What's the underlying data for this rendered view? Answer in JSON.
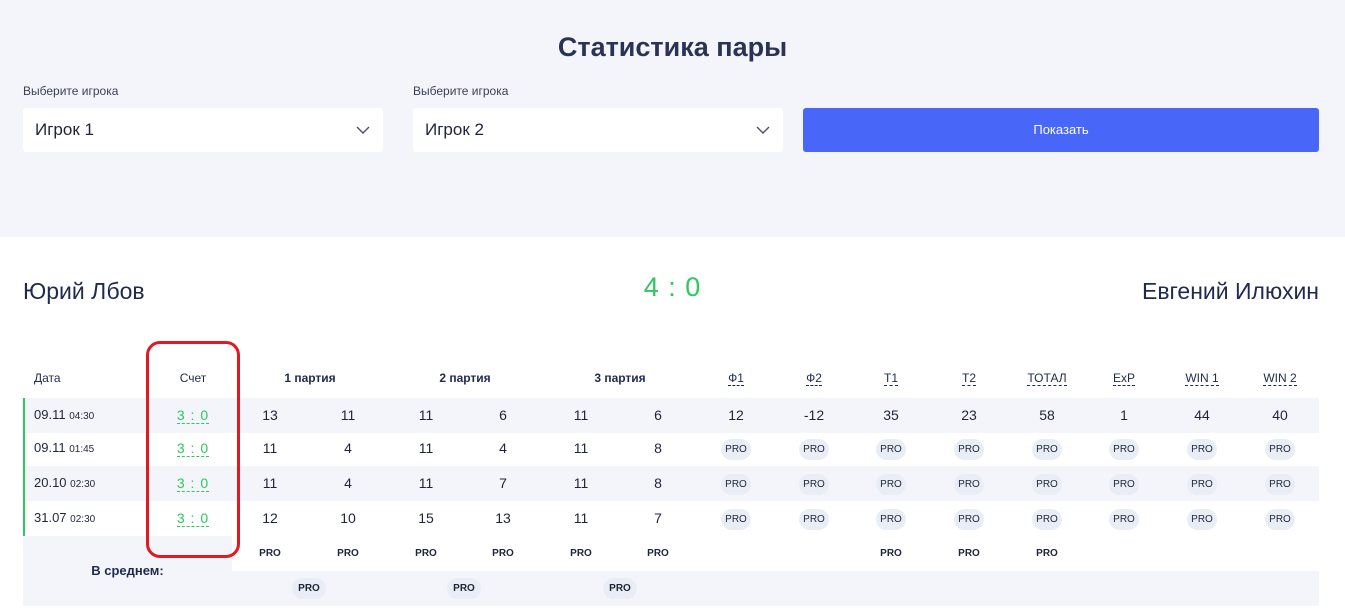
{
  "page": {
    "title": "Статистика пары"
  },
  "filters": {
    "player1_label": "Выберите игрока",
    "player1_value": "Игрок 1",
    "player2_label": "Выберите игрока",
    "player2_value": "Игрок 2",
    "show_button": "Показать"
  },
  "match": {
    "player1": "Юрий Лбов",
    "player2": "Евгений Илюхин",
    "total_score": "4 : 0"
  },
  "table": {
    "headers": {
      "date": "Дата",
      "score": "Счет",
      "set1": "1 партия",
      "set2": "2 партия",
      "set3": "3 партия",
      "f1": "Ф1",
      "f2": "Ф2",
      "t1": "Т1",
      "t2": "Т2",
      "total": "ТОТАЛ",
      "exp": "ExP",
      "win1": "WIN 1",
      "win2": "WIN 2"
    },
    "rows": [
      {
        "date": "09.11",
        "time": "04:30",
        "score": "3 : 0",
        "s1a": "13",
        "s1b": "11",
        "s2a": "11",
        "s2b": "6",
        "s3a": "11",
        "s3b": "6",
        "f1": "12",
        "f2": "-12",
        "t1": "35",
        "t2": "23",
        "total": "58",
        "exp": "1",
        "win1": "44",
        "win2": "40"
      },
      {
        "date": "09.11",
        "time": "01:45",
        "score": "3 : 0",
        "s1a": "11",
        "s1b": "4",
        "s2a": "11",
        "s2b": "4",
        "s3a": "11",
        "s3b": "8",
        "f1": "PRO",
        "f2": "PRO",
        "t1": "PRO",
        "t2": "PRO",
        "total": "PRO",
        "exp": "PRO",
        "win1": "PRO",
        "win2": "PRO"
      },
      {
        "date": "20.10",
        "time": "02:30",
        "score": "3 : 0",
        "s1a": "11",
        "s1b": "4",
        "s2a": "11",
        "s2b": "7",
        "s3a": "11",
        "s3b": "8",
        "f1": "PRO",
        "f2": "PRO",
        "t1": "PRO",
        "t2": "PRO",
        "total": "PRO",
        "exp": "PRO",
        "win1": "PRO",
        "win2": "PRO"
      },
      {
        "date": "31.07",
        "time": "02:30",
        "score": "3 : 0",
        "s1a": "12",
        "s1b": "10",
        "s2a": "15",
        "s2b": "13",
        "s3a": "11",
        "s3b": "7",
        "f1": "PRO",
        "f2": "PRO",
        "t1": "PRO",
        "t2": "PRO",
        "total": "PRO",
        "exp": "PRO",
        "win1": "PRO",
        "win2": "PRO"
      }
    ],
    "average": {
      "label": "В среднем:",
      "row1": [
        "PRO",
        "PRO",
        "PRO",
        "PRO",
        "PRO",
        "PRO",
        "PRO",
        "PRO",
        "PRO"
      ],
      "row2": [
        "PRO",
        "PRO",
        "PRO"
      ]
    }
  },
  "colors": {
    "accent": "#4866f8",
    "win": "#2ec760",
    "highlight": "#e11a22"
  }
}
